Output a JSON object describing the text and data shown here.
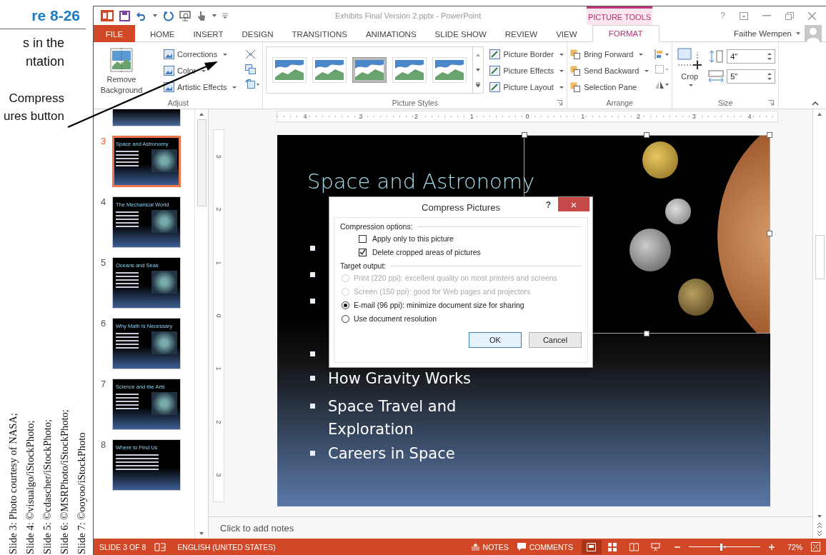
{
  "figure": {
    "label": "re 8-26",
    "caption_lines": [
      "s in the",
      "ntation"
    ],
    "callout_lines": [
      "Compress",
      "ures button"
    ],
    "credits": [
      "Slide 3: Photo courtesy of NASA;",
      "Slide 4: ©visualgo/iStockPhoto;",
      "Slide 5: ©cdascher/iStockPhoto;",
      "Slide 6: ©MSRPhoto/iStockPhoto;",
      "Slide 7: ©ooyoo/iStockPhoto"
    ]
  },
  "window": {
    "title": "Exhibits Final Version 2.pptx - PowerPoint",
    "contextual_group": "PICTURE TOOLS",
    "help": "?",
    "user": "Faithe Wempen"
  },
  "tabs": [
    {
      "label": "FILE",
      "kind": "file",
      "selected": false
    },
    {
      "label": "HOME",
      "kind": "normal",
      "selected": false
    },
    {
      "label": "INSERT",
      "kind": "normal",
      "selected": false
    },
    {
      "label": "DESIGN",
      "kind": "normal",
      "selected": false
    },
    {
      "label": "TRANSITIONS",
      "kind": "normal",
      "selected": false
    },
    {
      "label": "ANIMATIONS",
      "kind": "normal",
      "selected": false
    },
    {
      "label": "SLIDE SHOW",
      "kind": "normal",
      "selected": false
    },
    {
      "label": "REVIEW",
      "kind": "normal",
      "selected": false
    },
    {
      "label": "VIEW",
      "kind": "normal",
      "selected": false
    },
    {
      "label": "FORMAT",
      "kind": "contextual",
      "selected": true
    }
  ],
  "ribbon_groups": [
    {
      "kind": "adjust",
      "label": "Adjust",
      "big_button": "Remove Background",
      "commands": [
        {
          "label": "Corrections",
          "dropdown": true
        },
        {
          "label": "Color",
          "dropdown": true
        },
        {
          "label": "Artistic Effects",
          "dropdown": true
        }
      ]
    },
    {
      "kind": "styles",
      "label": "Picture Styles",
      "styles": [
        {
          "selected": false
        },
        {
          "selected": false
        },
        {
          "selected": true
        },
        {
          "selected": false
        },
        {
          "selected": false
        }
      ],
      "commands": [
        {
          "label": "Picture Border",
          "dropdown": true
        },
        {
          "label": "Picture Effects",
          "dropdown": true
        },
        {
          "label": "Picture Layout",
          "dropdown": true
        }
      ]
    },
    {
      "kind": "arrange",
      "label": "Arrange",
      "commands": [
        {
          "label": "Bring Forward",
          "dropdown": true
        },
        {
          "label": "Send Backward",
          "dropdown": true
        },
        {
          "label": "Selection Pane",
          "dropdown": false
        }
      ]
    },
    {
      "kind": "size",
      "label": "Size",
      "big_button": "Crop",
      "height": "4\"",
      "width": "5\""
    }
  ],
  "slides": [
    {
      "number": "3",
      "title": "Space and Astronomy",
      "selected": true,
      "has_picture": true
    },
    {
      "number": "4",
      "title": "The Mechanical World",
      "selected": false,
      "has_picture": true
    },
    {
      "number": "5",
      "title": "Oceans and Seas",
      "selected": false,
      "has_picture": true
    },
    {
      "number": "6",
      "title": "Why Math Is Necessary",
      "selected": false,
      "has_picture": true
    },
    {
      "number": "7",
      "title": "Science and the Arts",
      "selected": false,
      "has_picture": true
    },
    {
      "number": "8",
      "title": "Where to Find Us",
      "selected": false,
      "has_picture": false
    }
  ],
  "rulers": {
    "horizontal": [
      "4",
      "3",
      "2",
      "1",
      "0",
      "1",
      "2",
      "3",
      "4"
    ],
    "vertical": [
      "3",
      "2",
      "1",
      "0",
      "1",
      "2",
      "3"
    ]
  },
  "slide": {
    "title": "Space and Astronomy",
    "bullets": [
      "How Gravity Works",
      "Space Travel and Exploration",
      "Careers in Space"
    ]
  },
  "dialog": {
    "title": "Compress Pictures",
    "help": "?",
    "close": "×",
    "options_heading": "Compression options:",
    "checkboxes": [
      {
        "label": "Apply only to this picture",
        "checked": false
      },
      {
        "label": "Delete cropped areas of pictures",
        "checked": true
      }
    ],
    "output_heading": "Target output:",
    "radios": [
      {
        "label": "Print (220 ppi): excellent quality on most printers and screens",
        "selected": false,
        "disabled": true
      },
      {
        "label": "Screen (150 ppi): good for Web pages and projectors",
        "selected": false,
        "disabled": true
      },
      {
        "label": "E-mail (96 ppi): minimize document size for sharing",
        "selected": true,
        "disabled": false
      },
      {
        "label": "Use document resolution",
        "selected": false,
        "disabled": false
      }
    ],
    "buttons": [
      {
        "label": "OK",
        "default": true
      },
      {
        "label": "Cancel",
        "default": false
      }
    ]
  },
  "notes": {
    "placeholder": "Click to add notes"
  },
  "status_bar": {
    "slide": "SLIDE 3 OF 8",
    "language": "ENGLISH (UNITED STATES)",
    "notes": "NOTES",
    "comments": "COMMENTS",
    "views": [
      {
        "selected": true
      },
      {
        "selected": false
      },
      {
        "selected": false
      },
      {
        "selected": false
      }
    ],
    "zoom": {
      "level": 0.45
    },
    "zoom_reading": "72%"
  }
}
